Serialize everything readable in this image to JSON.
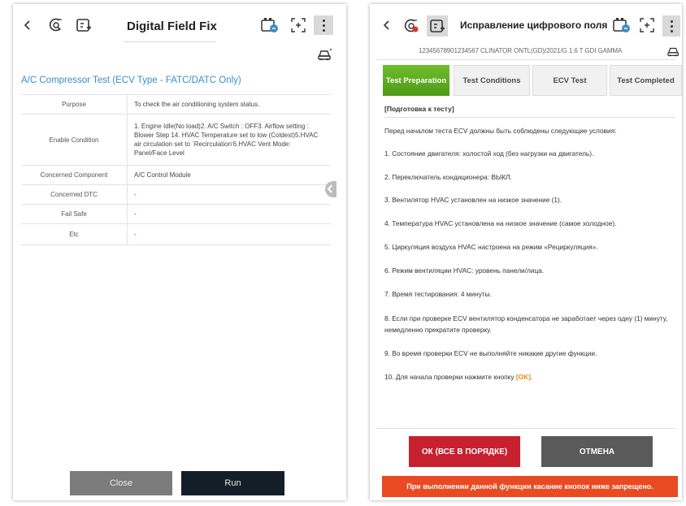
{
  "left": {
    "header": {
      "title": "Digital Field Fix",
      "icons": [
        "back-icon",
        "dtc-scan-icon",
        "ecu-icon",
        "battery-icon",
        "screenshot-icon",
        "more-icon",
        "vehicle-icon"
      ]
    },
    "subtitle": "A/C Compressor Test (ECV Type - FATC/DATC Only)",
    "table": [
      {
        "label": "Purpose",
        "value": "To check the air conditioning system status."
      },
      {
        "label": "Enable Condition",
        "value": "1. Engine Idle(No load)2. A/C Switch : OFF3. Airflow setting : Blower Step 14. HVAC Temperature set to low (Coldest)5.HVAC air circulation set to `Recirculation'6.HVAC Vent Mode: Panel/Face Level"
      },
      {
        "label": "Concerned Component",
        "value": "A/C Control Module"
      },
      {
        "label": "Concerned DTC",
        "value": "-"
      },
      {
        "label": "Fail Safe",
        "value": "-"
      },
      {
        "label": "Etc",
        "value": "-"
      }
    ],
    "buttons": {
      "close": "Close",
      "run": "Run"
    }
  },
  "right": {
    "header": {
      "title": "Исправление цифрового поля"
    },
    "vehicle_info": "12345678901234567  CLINATOR ONTL(GD)/2021/G 1.6 T  GDI GAMMA",
    "tabs": [
      "Test Preparation",
      "Test Conditions",
      "ECV Test",
      "Test Completed"
    ],
    "active_tab": "Test Preparation",
    "section_title": "[Подготовка к тесту]",
    "intro": "Перед началом теста ECV должны быть соблюдены следующие условия:",
    "steps": [
      "1. Состояние двигателя: холостой ход (без нагрузки на двигатель).",
      "2. Переключатель кондиционера: ВЫКЛ.",
      "3. Вентилятор HVAC установлен на низкое значение (1).",
      "4. Температура HVAC установлена на низкое значение (самое холодное).",
      "5. Циркуляция воздуха HVAC настроена на режим «Рециркуляция».",
      "6. Режим вентиляции HVAC: уровень панели/лица.",
      "7. Время тестирования: 4 минуты.",
      "8. Если при проверке ECV вентилятор конденсатора не заработает через одну (1) минуту, немедленно прекратите проверку.",
      "9. Во время проверки ECV не выполняйте никакие другие функции."
    ],
    "step10_prefix": "10. Для начала проверки нажмите кнопку",
    "step10_ok": "[OK]",
    "step10_suffix": ".",
    "buttons": {
      "ok": "ОК (ВСЕ В ПОРЯДКЕ)",
      "cancel": "ОТМЕНА"
    },
    "warning": "При выполнении данной функции касание кнопок ниже запрещено."
  },
  "colors": {
    "accent_blue": "#3a8fc8",
    "tab_active_green": "#5fae22",
    "ok_red": "#c7202f",
    "cancel_gray": "#5a5a5a",
    "warning_orange": "#e94a22",
    "run_dark": "#141e28",
    "close_gray": "#7b7b7b"
  }
}
